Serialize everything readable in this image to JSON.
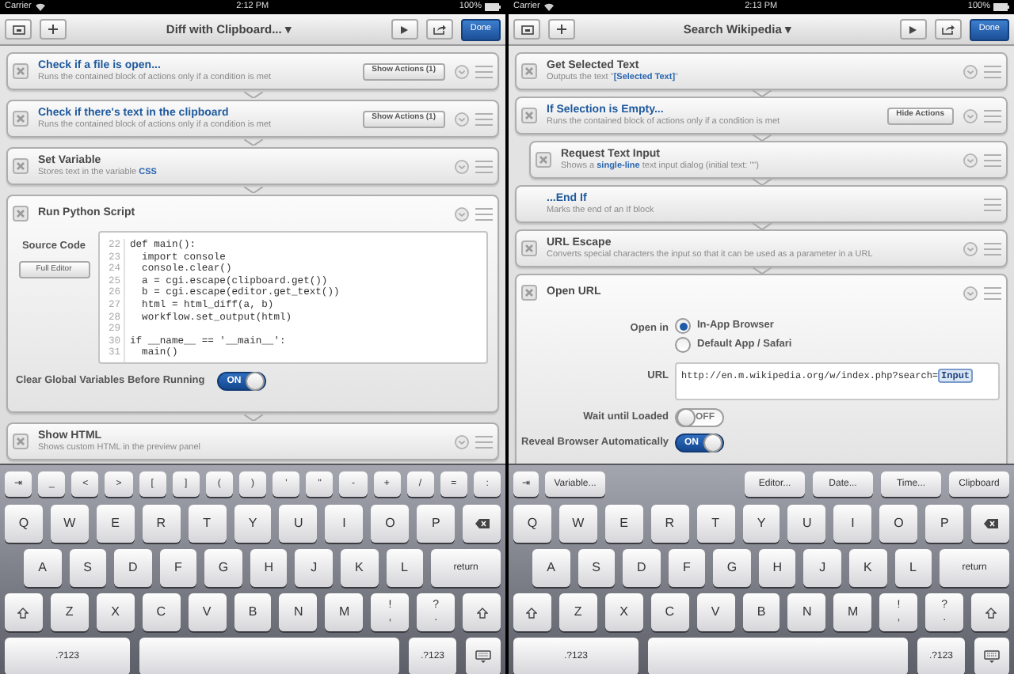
{
  "panes": [
    {
      "status_bar": {
        "carrier": "Carrier",
        "time": "2:12 PM",
        "battery": "100%"
      },
      "toolbar": {
        "title": "Diff with Clipboard...",
        "caret": "▾",
        "done": "Done"
      },
      "actions": [
        {
          "kind": "condition",
          "title": "Check if a file is open...",
          "subtitle": [
            {
              "text": "Runs the contained block of actions only if a condition is met"
            }
          ],
          "button": "Show Actions (1)"
        },
        {
          "kind": "condition",
          "title": "Check if there's text in the clipboard",
          "subtitle": [
            {
              "text": "Runs the contained block of actions only if a condition is met"
            }
          ],
          "button": "Show Actions (1)"
        },
        {
          "kind": "action",
          "title": "Set Variable",
          "subtitle": [
            {
              "text": "Stores text in the variable "
            },
            {
              "text": "CSS",
              "token": true
            }
          ]
        },
        {
          "kind": "action",
          "title": "Run Python Script",
          "body": {
            "kind": "python",
            "fields": [
              {
                "kind": "code",
                "label": "Source Code",
                "button": "Full Editor",
                "lines": [
                  {
                    "number": "22",
                    "code": "def main():"
                  },
                  {
                    "number": "23",
                    "code": "  import console"
                  },
                  {
                    "number": "24",
                    "code": "  console.clear()"
                  },
                  {
                    "number": "25",
                    "code": "  a = cgi.escape(clipboard.get())"
                  },
                  {
                    "number": "26",
                    "code": "  b = cgi.escape(editor.get_text())"
                  },
                  {
                    "number": "27",
                    "code": "  html = html_diff(a, b)"
                  },
                  {
                    "number": "28",
                    "code": "  workflow.set_output(html)"
                  },
                  {
                    "number": "29"
                  },
                  {
                    "number": "30",
                    "code": "if __name__ == '__main__':"
                  },
                  {
                    "number": "31",
                    "code": "  main()"
                  }
                ]
              },
              {
                "kind": "toggle",
                "label": "Clear Global Variables Before Running",
                "on": true,
                "text": "ON"
              }
            ]
          }
        },
        {
          "kind": "action",
          "title": "Show HTML",
          "subtitle": [
            {
              "text": "Shows custom HTML in the preview panel"
            }
          ]
        }
      ],
      "keyboard": {
        "accessory_start": [
          {
            "label": "⇥"
          },
          {
            "label": "_"
          },
          {
            "label": "<"
          },
          {
            "label": ">"
          },
          {
            "label": "["
          },
          {
            "label": "]"
          },
          {
            "label": "("
          },
          {
            "label": ")"
          },
          {
            "label": "'"
          },
          {
            "label": "\""
          },
          {
            "label": "-"
          },
          {
            "label": "+"
          },
          {
            "label": "/"
          },
          {
            "label": "="
          },
          {
            "label": ":"
          }
        ],
        "rows": [
          {
            "keys": [
              {
                "kind": "char",
                "label": "Q"
              },
              {
                "kind": "char",
                "label": "W"
              },
              {
                "kind": "char",
                "label": "E"
              },
              {
                "kind": "char",
                "label": "R"
              },
              {
                "kind": "char",
                "label": "T"
              },
              {
                "kind": "char",
                "label": "Y"
              },
              {
                "kind": "char",
                "label": "U"
              },
              {
                "kind": "char",
                "label": "I"
              },
              {
                "kind": "char",
                "label": "O"
              },
              {
                "kind": "char",
                "label": "P"
              },
              {
                "kind": "delete"
              }
            ]
          },
          {
            "keys": [
              {
                "kind": "char",
                "label": "A"
              },
              {
                "kind": "char",
                "label": "S"
              },
              {
                "kind": "char",
                "label": "D"
              },
              {
                "kind": "char",
                "label": "F"
              },
              {
                "kind": "char",
                "label": "G"
              },
              {
                "kind": "char",
                "label": "H"
              },
              {
                "kind": "char",
                "label": "J"
              },
              {
                "kind": "char",
                "label": "K"
              },
              {
                "kind": "char",
                "label": "L"
              },
              {
                "kind": "return",
                "label": "return"
              }
            ]
          },
          {
            "keys": [
              {
                "kind": "shift"
              },
              {
                "kind": "char",
                "label": "Z"
              },
              {
                "kind": "char",
                "label": "X"
              },
              {
                "kind": "char",
                "label": "C"
              },
              {
                "kind": "char",
                "label": "V"
              },
              {
                "kind": "char",
                "label": "B"
              },
              {
                "kind": "char",
                "label": "N"
              },
              {
                "kind": "char",
                "label": "M"
              },
              {
                "kind": "stack",
                "top": "!",
                "bottom": ","
              },
              {
                "kind": "stack",
                "top": "?",
                "bottom": "."
              },
              {
                "kind": "shift"
              }
            ]
          },
          {
            "keys": [
              {
                "kind": "mode",
                "label": ".?123"
              },
              {
                "kind": "space"
              },
              {
                "kind": "mode",
                "label": ".?123"
              },
              {
                "kind": "hide"
              }
            ]
          }
        ]
      }
    },
    {
      "status_bar": {
        "carrier": "Carrier",
        "time": "2:13 PM",
        "battery": "100%"
      },
      "toolbar": {
        "title": "Search Wikipedia",
        "caret": "▾",
        "done": "Done"
      },
      "actions": [
        {
          "kind": "action",
          "title": "Get Selected Text",
          "subtitle": [
            {
              "text": "Outputs the text \""
            },
            {
              "text": "[Selected Text]",
              "token": true
            },
            {
              "text": "\""
            }
          ]
        },
        {
          "kind": "condition",
          "title": "If Selection is Empty...",
          "subtitle": [
            {
              "text": "Runs the contained block of actions only if a condition is met"
            }
          ],
          "button": "Hide Actions",
          "children": [
            {
              "kind": "action",
              "title": "Request Text Input",
              "subtitle": [
                {
                  "text": "Shows a "
                },
                {
                  "text": "single-line",
                  "token": true
                },
                {
                  "text": " text input dialog (initial text: \"\")"
                }
              ]
            }
          ]
        },
        {
          "kind": "end",
          "title": "...End If",
          "subtitle": [
            {
              "text": "Marks the end of an If block"
            }
          ]
        },
        {
          "kind": "action",
          "title": "URL Escape",
          "subtitle": [
            {
              "text": "Converts special characters the input so that it can be used as a parameter in a URL"
            }
          ]
        },
        {
          "kind": "action",
          "title": "Open URL",
          "body": {
            "kind": "open_url",
            "fields": [
              {
                "kind": "radio",
                "label": "Open in",
                "options": [
                  {
                    "text": "In-App Browser",
                    "selected": true
                  },
                  {
                    "text": "Default App / Safari",
                    "selected": false
                  }
                ]
              },
              {
                "kind": "url",
                "label": "URL",
                "value": "http://en.m.wikipedia.org/w/index.php?search=",
                "token": "Input"
              },
              {
                "kind": "toggle",
                "label": "Wait until Loaded",
                "on": false,
                "text": "OFF"
              },
              {
                "kind": "toggle",
                "label": "Reveal Browser Automatically",
                "on": true,
                "text": "ON"
              }
            ]
          }
        }
      ],
      "keyboard": {
        "accessory_start": [
          {
            "label": "⇥"
          },
          {
            "label": "Variable..."
          }
        ],
        "accessory_end": [
          {
            "label": "Editor..."
          },
          {
            "label": "Date..."
          },
          {
            "label": "Time..."
          },
          {
            "label": "Clipboard"
          }
        ],
        "rows": [
          {
            "keys": [
              {
                "kind": "char",
                "label": "Q"
              },
              {
                "kind": "char",
                "label": "W"
              },
              {
                "kind": "char",
                "label": "E"
              },
              {
                "kind": "char",
                "label": "R"
              },
              {
                "kind": "char",
                "label": "T"
              },
              {
                "kind": "char",
                "label": "Y"
              },
              {
                "kind": "char",
                "label": "U"
              },
              {
                "kind": "char",
                "label": "I"
              },
              {
                "kind": "char",
                "label": "O"
              },
              {
                "kind": "char",
                "label": "P"
              },
              {
                "kind": "delete"
              }
            ]
          },
          {
            "keys": [
              {
                "kind": "char",
                "label": "A"
              },
              {
                "kind": "char",
                "label": "S"
              },
              {
                "kind": "char",
                "label": "D"
              },
              {
                "kind": "char",
                "label": "F"
              },
              {
                "kind": "char",
                "label": "G"
              },
              {
                "kind": "char",
                "label": "H"
              },
              {
                "kind": "char",
                "label": "J"
              },
              {
                "kind": "char",
                "label": "K"
              },
              {
                "kind": "char",
                "label": "L"
              },
              {
                "kind": "return",
                "label": "return"
              }
            ]
          },
          {
            "keys": [
              {
                "kind": "shift"
              },
              {
                "kind": "char",
                "label": "Z"
              },
              {
                "kind": "char",
                "label": "X"
              },
              {
                "kind": "char",
                "label": "C"
              },
              {
                "kind": "char",
                "label": "V"
              },
              {
                "kind": "char",
                "label": "B"
              },
              {
                "kind": "char",
                "label": "N"
              },
              {
                "kind": "char",
                "label": "M"
              },
              {
                "kind": "stack",
                "top": "!",
                "bottom": ","
              },
              {
                "kind": "stack",
                "top": "?",
                "bottom": "."
              },
              {
                "kind": "shift"
              }
            ]
          },
          {
            "keys": [
              {
                "kind": "mode",
                "label": ".?123"
              },
              {
                "kind": "space"
              },
              {
                "kind": "mode",
                "label": ".?123"
              },
              {
                "kind": "hide"
              }
            ]
          }
        ]
      }
    }
  ]
}
